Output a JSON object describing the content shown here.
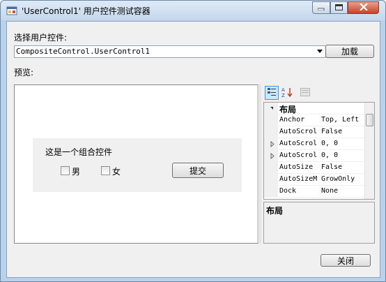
{
  "window": {
    "title": "'UserControl1' 用户控件测试容器",
    "minimize_icon": "minimize-icon",
    "maximize_icon": "maximize-icon",
    "close_icon": "close-icon"
  },
  "selector": {
    "label": "选择用户控件:",
    "value": "CompositeControl.UserControl1",
    "load_button": "加载"
  },
  "preview": {
    "label": "预览:",
    "control": {
      "heading": "这是一个组合控件",
      "checkbox_male": "男",
      "checkbox_female": "女",
      "submit_button": "提交"
    }
  },
  "property_grid": {
    "toolbar": [
      "categorized-icon",
      "alphabetical-icon",
      "property-pages-icon"
    ],
    "category": "布局",
    "rows": [
      {
        "name": "Anchor",
        "value": "Top, Left",
        "expandable": false
      },
      {
        "name": "AutoScrol",
        "value": "False",
        "expandable": false
      },
      {
        "name": "AutoScrol",
        "value": "0, 0",
        "expandable": true
      },
      {
        "name": "AutoScrol",
        "value": "0, 0",
        "expandable": true
      },
      {
        "name": "AutoSize",
        "value": "False",
        "expandable": false
      },
      {
        "name": "AutoSizeM",
        "value": "GrowOnly",
        "expandable": false
      },
      {
        "name": "Dock",
        "value": "None",
        "expandable": false
      }
    ],
    "description_title": "布局"
  },
  "footer": {
    "close_button": "关闭"
  }
}
